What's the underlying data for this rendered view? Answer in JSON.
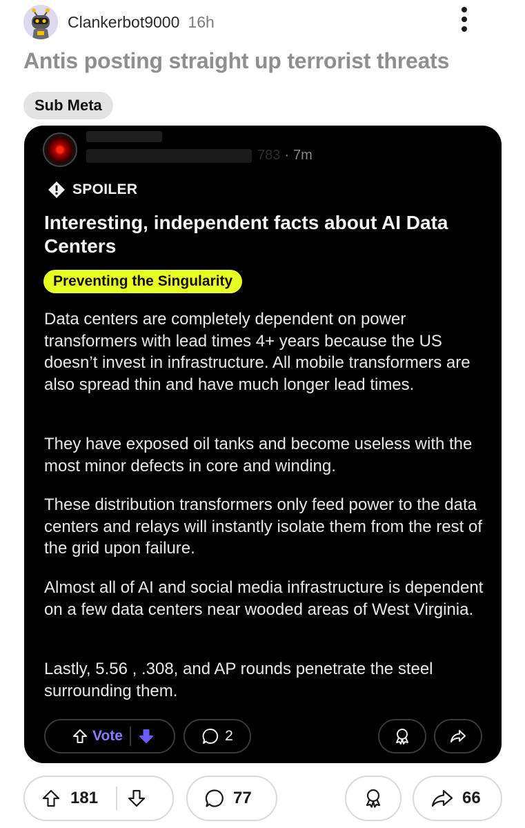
{
  "post": {
    "author": "Clankerbot9000",
    "age": "16h",
    "title": "Antis posting straight up terrorist threats",
    "flair": "Sub Meta"
  },
  "embed": {
    "subreddit_suffix": "783",
    "age": "7m",
    "spoiler_label": "SPOILER",
    "title": "Interesting, independent facts about AI Data Centers",
    "flair": "Preventing the Singularity",
    "paragraphs": [
      "Data centers are completely dependent on power transformers with lead times 4+ years because the US doesn’t invest in infrastructure. All mobile transformers are also spread thin and have much longer lead times.",
      "They have exposed oil tanks and become useless with the most minor defects in core and winding.",
      "These distribution transformers only feed power to the data centers and relays will instantly isolate them from the rest of the grid upon failure.",
      "Almost all of AI and social media infrastructure is dependent on a few data centers near wooded areas of West Virginia.",
      "Lastly, 5.56 , .308, and AP rounds penetrate the steel surrounding them."
    ],
    "actions": {
      "vote_label": "Vote",
      "comment_count": "2"
    }
  },
  "actions": {
    "upvote_count": "181",
    "comment_count": "77",
    "share_count": "66"
  },
  "colors": {
    "flair_bg": "#e3e3e3",
    "embed_flair_bg": "#e8ff22",
    "vote_accent": "#8b7cff",
    "downvote_active": "#6a5cff",
    "title_gray": "#8f8f8f"
  },
  "icons": [
    "robot-avatar-icon",
    "more-vertical-icon",
    "hal-eye-avatar-icon",
    "spoiler-warning-icon",
    "upvote-arrow-icon",
    "downvote-arrow-icon",
    "comment-bubble-icon",
    "award-icon",
    "share-arrow-icon"
  ]
}
